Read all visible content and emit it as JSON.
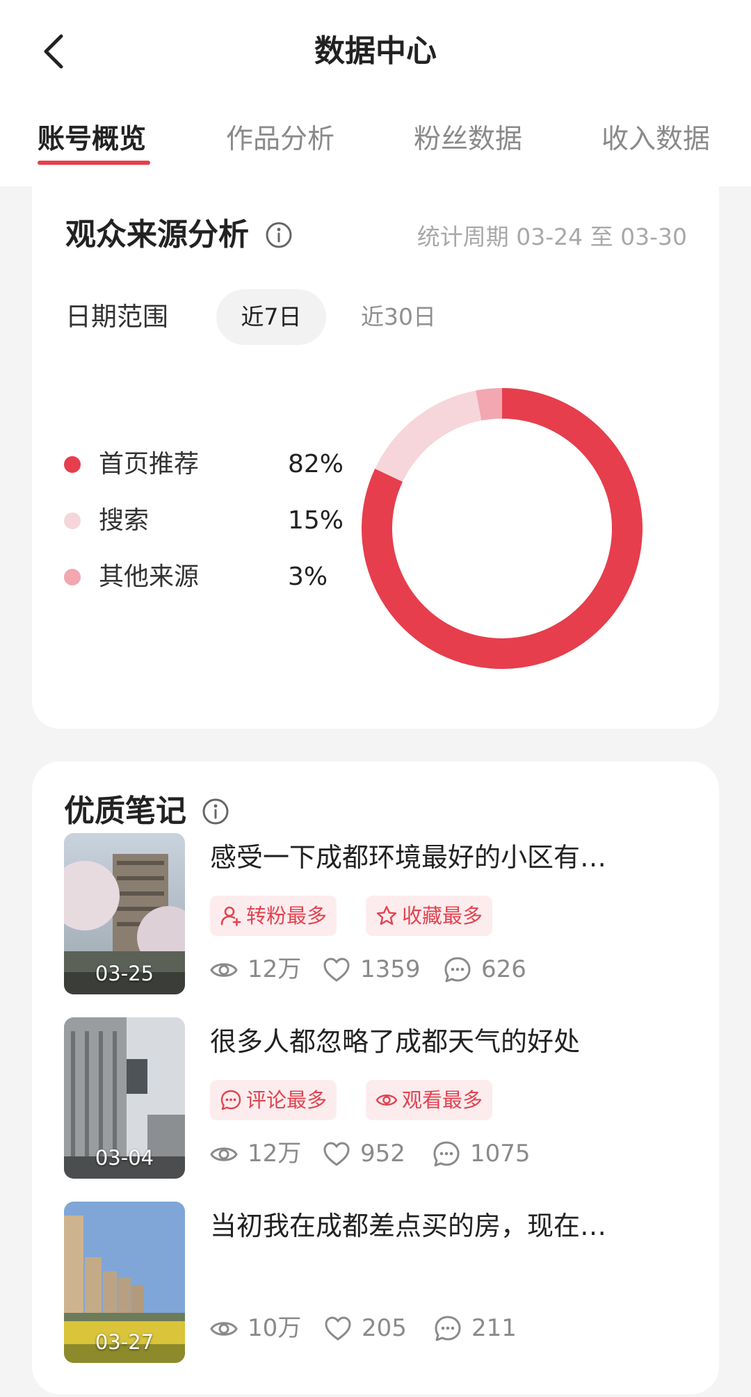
{
  "header": {
    "title": "数据中心",
    "back_icon": "chevron-left-icon"
  },
  "tabs": [
    {
      "label": "账号概览",
      "active": true
    },
    {
      "label": "作品分析",
      "active": false
    },
    {
      "label": "粉丝数据",
      "active": false
    },
    {
      "label": "收入数据",
      "active": false
    }
  ],
  "colors": {
    "accent": "#e63e4d",
    "search": "#f6d6da",
    "other": "#f2a7b1",
    "badge_bg": "#fdecee",
    "badge_text": "#e2434f"
  },
  "audience": {
    "title": "观众来源分析",
    "info_icon": "info-icon",
    "period": "统计周期 03-24 至 03-30",
    "range_label": "日期范围",
    "range_options": [
      {
        "label": "近7日",
        "selected": true
      },
      {
        "label": "近30日",
        "selected": false
      }
    ]
  },
  "chart_data": {
    "type": "pie",
    "donut": true,
    "categories": [
      "首页推荐",
      "搜索",
      "其他来源"
    ],
    "values": [
      82,
      15,
      3
    ],
    "labels": [
      "82%",
      "15%",
      "3%"
    ],
    "colors": [
      "#e63e4d",
      "#f6d6da",
      "#f2a7b1"
    ],
    "legend_placement": "left"
  },
  "notes_section": {
    "title": "优质笔记",
    "info_icon": "info-icon",
    "notes": [
      {
        "date": "03-25",
        "title": "感受一下成都环境最好的小区有…",
        "badges": [
          {
            "label": "转粉最多",
            "icon": "user-plus-icon"
          },
          {
            "label": "收藏最多",
            "icon": "star-icon"
          }
        ],
        "views": "12万",
        "likes": "1359",
        "comments": "626"
      },
      {
        "date": "03-04",
        "title": "很多人都忽略了成都天气的好处",
        "badges": [
          {
            "label": "评论最多",
            "icon": "comment-icon"
          },
          {
            "label": "观看最多",
            "icon": "eye-icon"
          }
        ],
        "views": "12万",
        "likes": "952",
        "comments": "1075"
      },
      {
        "date": "03-27",
        "title": "当初我在成都差点买的房，现在…",
        "badges": [],
        "views": "10万",
        "likes": "205",
        "comments": "211"
      }
    ]
  }
}
